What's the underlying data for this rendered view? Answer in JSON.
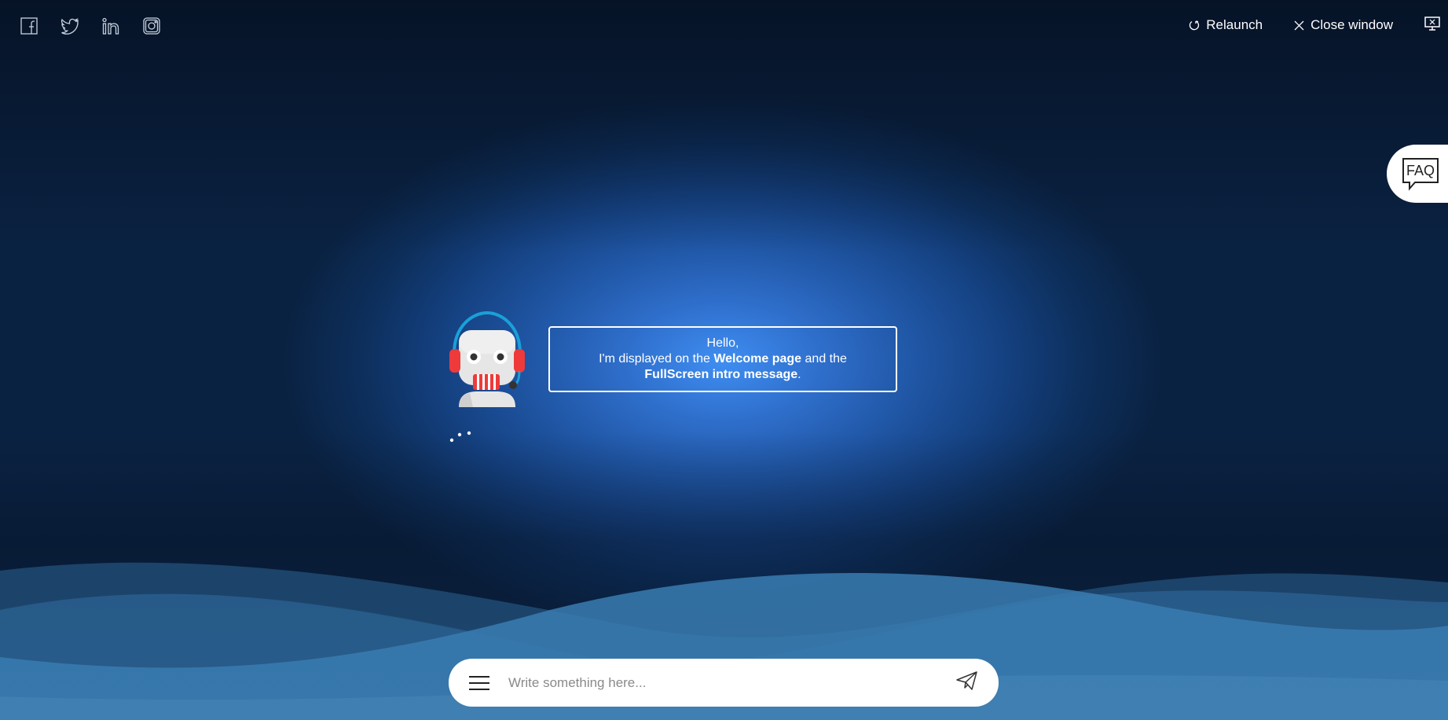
{
  "social": {
    "icons": [
      "facebook-icon",
      "twitter-icon",
      "linkedin-icon",
      "instagram-icon"
    ]
  },
  "header": {
    "relaunch_label": "Relaunch",
    "close_label": "Close window",
    "relaunch_icon": "refresh-icon",
    "close_icon": "close-icon",
    "screen_icon": "screen-toggle-icon"
  },
  "faq": {
    "label": "FAQ"
  },
  "message": {
    "greeting": "Hello,",
    "line_start": "I'm displayed on the ",
    "welcome": "Welcome page",
    "and_the": " and the",
    "fullscreen": "FullScreen intro message",
    "period": "."
  },
  "composer": {
    "placeholder": "Write something here...",
    "menu_icon": "hamburger-menu-icon",
    "send_icon": "paper-plane-send-icon"
  },
  "colors": {
    "accent": "#2f6fcc",
    "background_dark": "#0a2242",
    "wave": "#3a7bb0",
    "headset_red": "#ee3a3a",
    "headset_blue": "#1aa0d8"
  }
}
